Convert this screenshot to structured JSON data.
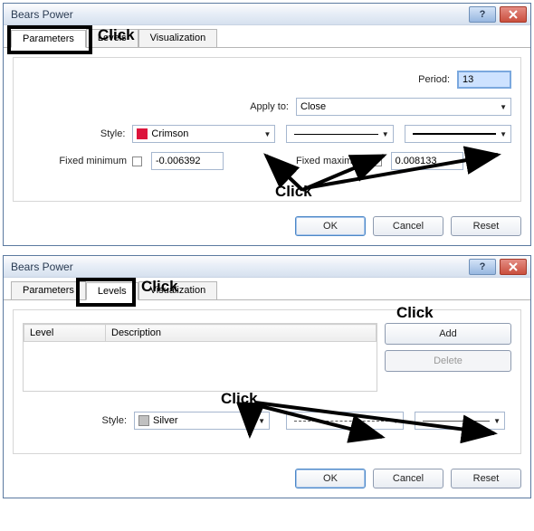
{
  "windowTitle": "Bears Power",
  "tabs": {
    "parameters": "Parameters",
    "levels": "Levels",
    "visualization": "Visualization"
  },
  "params": {
    "periodLabel": "Period:",
    "periodValue": "13",
    "applyLabel": "Apply to:",
    "applyValue": "Close",
    "styleLabel": "Style:",
    "styleValue": "Crimson",
    "fixedMinLabel": "Fixed minimum",
    "fixedMinValue": "-0.006392",
    "fixedMaxLabel": "Fixed maximum",
    "fixedMaxValue": "0.008133"
  },
  "levels": {
    "colLevel": "Level",
    "colDesc": "Description",
    "addLabel": "Add",
    "deleteLabel": "Delete",
    "styleLabel": "Style:",
    "styleValue": "Silver"
  },
  "buttons": {
    "ok": "OK",
    "cancel": "Cancel",
    "reset": "Reset"
  },
  "annotations": {
    "click": "Click"
  }
}
